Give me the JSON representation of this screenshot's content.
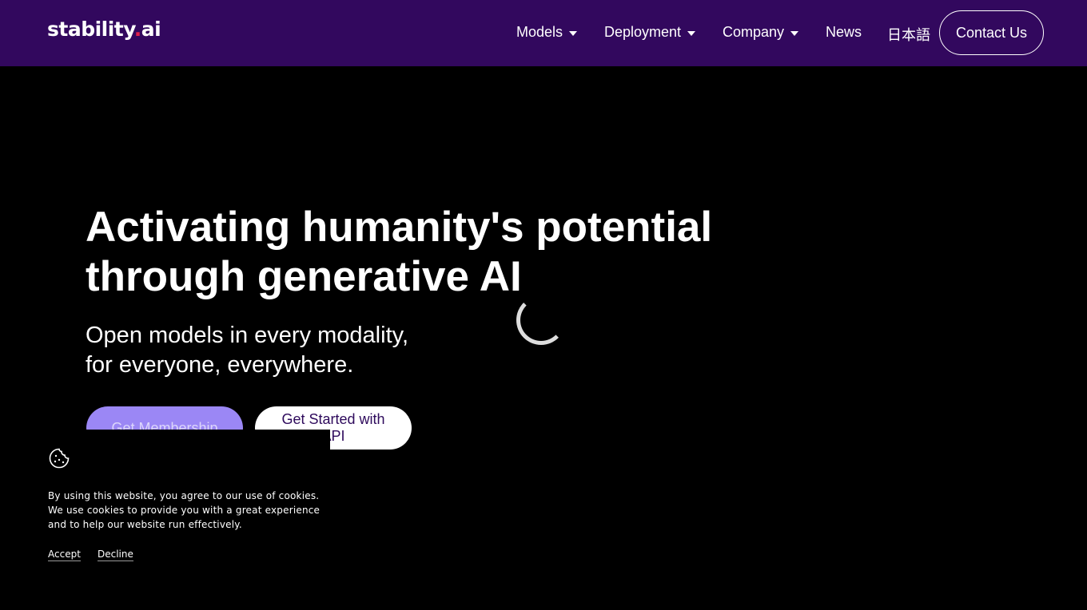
{
  "nav": {
    "logo_main": "stability",
    "logo_dot": ".",
    "logo_suffix": "ai",
    "items": [
      {
        "label": "Models",
        "has_dropdown": true
      },
      {
        "label": "Deployment",
        "has_dropdown": true
      },
      {
        "label": "Company",
        "has_dropdown": true
      },
      {
        "label": "News",
        "has_dropdown": false
      },
      {
        "label": "日本語",
        "has_dropdown": false
      }
    ],
    "contact_label": "Contact Us",
    "background": "#32085e"
  },
  "hero": {
    "title": "Activating humanity's potential through generative AI",
    "subtitle_line1": "Open models in every modality,",
    "subtitle_line2": "for everyone, everywhere.",
    "primary_button": "Get Membership",
    "secondary_button": "Get Started with API",
    "accent": "#9b87f5"
  },
  "cookie": {
    "icon": "cookie-icon",
    "text": "By using this website, you agree to our use of cookies. We use cookies to provide you with a great experience and to help our website run effectively.",
    "accept": "Accept",
    "decline": "Decline"
  }
}
